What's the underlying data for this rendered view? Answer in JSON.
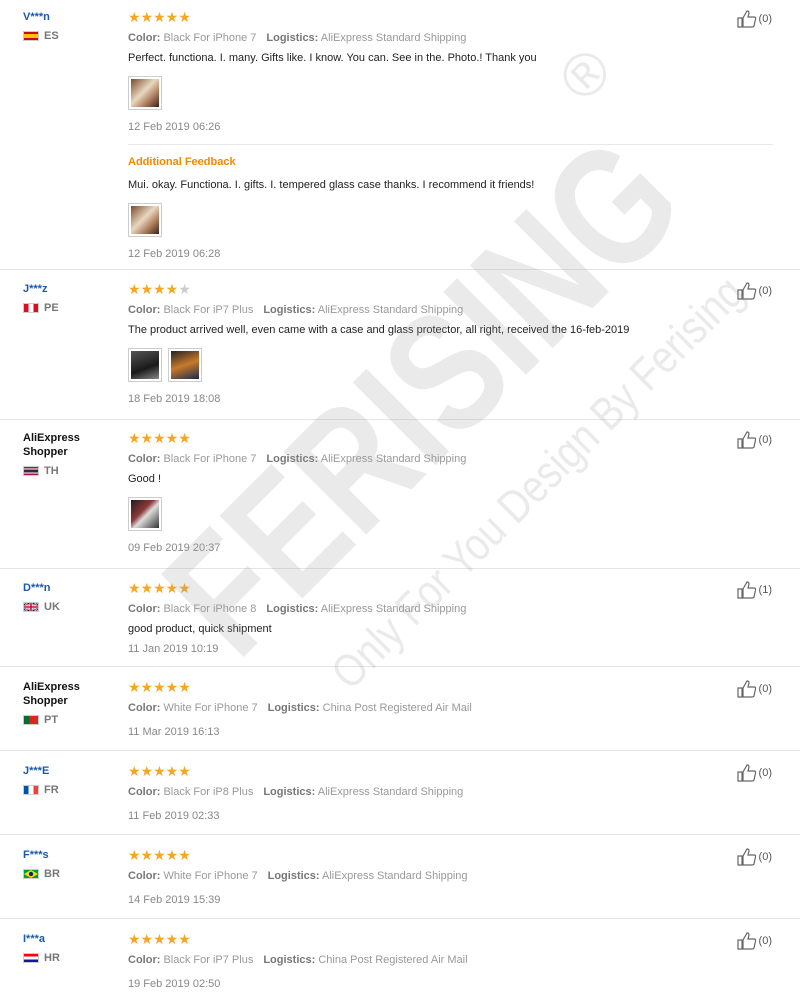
{
  "reviews": [
    {
      "user": "V***n",
      "shopper": false,
      "country": "ES",
      "flag": "es",
      "stars": 5,
      "color_label": "Color:",
      "color": "Black For iPhone 7",
      "logistics_label": "Logistics:",
      "logistics": "AliExpress Standard Shipping",
      "text": "Perfect. functiona. I. many. Gifts like. I know. You can. See in the. Photo.! Thank you",
      "photos": 1,
      "date": "12 Feb 2019 06:26",
      "helpful": "(0)",
      "additional": {
        "label": "Additional Feedback",
        "text": "Mui. okay. Functiona. I. gifts. I. tempered glass case thanks. I recommend it friends!",
        "photos": 1,
        "date": "12 Feb 2019 06:28"
      }
    },
    {
      "user": "J***z",
      "shopper": false,
      "country": "PE",
      "flag": "pe",
      "stars": 4,
      "color_label": "Color:",
      "color": "Black For iP7 Plus",
      "logistics_label": "Logistics:",
      "logistics": "AliExpress Standard Shipping",
      "text": "The product arrived well, even came with a case and glass protector, all right, received the 16-feb-2019",
      "photos": 2,
      "date": "18 Feb 2019 18:08",
      "helpful": "(0)"
    },
    {
      "user": "AliExpress Shopper",
      "shopper": true,
      "country": "TH",
      "flag": "th",
      "stars": 5,
      "color_label": "Color:",
      "color": "Black For iPhone 7",
      "logistics_label": "Logistics:",
      "logistics": "AliExpress Standard Shipping",
      "text": "Good !",
      "photos": 1,
      "date": "09 Feb 2019 20:37",
      "helpful": "(0)"
    },
    {
      "user": "D***n",
      "shopper": false,
      "country": "UK",
      "flag": "uk",
      "stars": 5,
      "color_label": "Color:",
      "color": "Black For iPhone 8",
      "logistics_label": "Logistics:",
      "logistics": "AliExpress Standard Shipping",
      "text": "good product, quick shipment",
      "photos": 0,
      "date": "11 Jan 2019 10:19",
      "helpful": "(1)"
    },
    {
      "user": "AliExpress Shopper",
      "shopper": true,
      "country": "PT",
      "flag": "pt",
      "stars": 5,
      "color_label": "Color:",
      "color": "White For iPhone 7",
      "logistics_label": "Logistics:",
      "logistics": "China Post Registered Air Mail",
      "text": "",
      "photos": 0,
      "date": "11 Mar 2019 16:13",
      "helpful": "(0)"
    },
    {
      "user": "J***E",
      "shopper": false,
      "country": "FR",
      "flag": "fr",
      "stars": 5,
      "color_label": "Color:",
      "color": "Black For iP8 Plus",
      "logistics_label": "Logistics:",
      "logistics": "AliExpress Standard Shipping",
      "text": "",
      "photos": 0,
      "date": "11 Feb 2019 02:33",
      "helpful": "(0)"
    },
    {
      "user": "F***s",
      "shopper": false,
      "country": "BR",
      "flag": "br",
      "stars": 5,
      "color_label": "Color:",
      "color": "White For iPhone 7",
      "logistics_label": "Logistics:",
      "logistics": "AliExpress Standard Shipping",
      "text": "",
      "photos": 0,
      "date": "14 Feb 2019 15:39",
      "helpful": "(0)"
    },
    {
      "user": "I***a",
      "shopper": false,
      "country": "HR",
      "flag": "hr",
      "stars": 5,
      "color_label": "Color:",
      "color": "Black For iP7 Plus",
      "logistics_label": "Logistics:",
      "logistics": "China Post Registered Air Mail",
      "text": "",
      "photos": 0,
      "date": "19 Feb 2019 02:50",
      "helpful": "(0)"
    }
  ],
  "watermark": {
    "logo": "FERISING",
    "registered": "®",
    "tagline": "Only For You Design By Ferising"
  },
  "colors": {
    "username": "#1b5aa8",
    "star": "#f5a623",
    "additional_feedback": "#f08a00"
  }
}
